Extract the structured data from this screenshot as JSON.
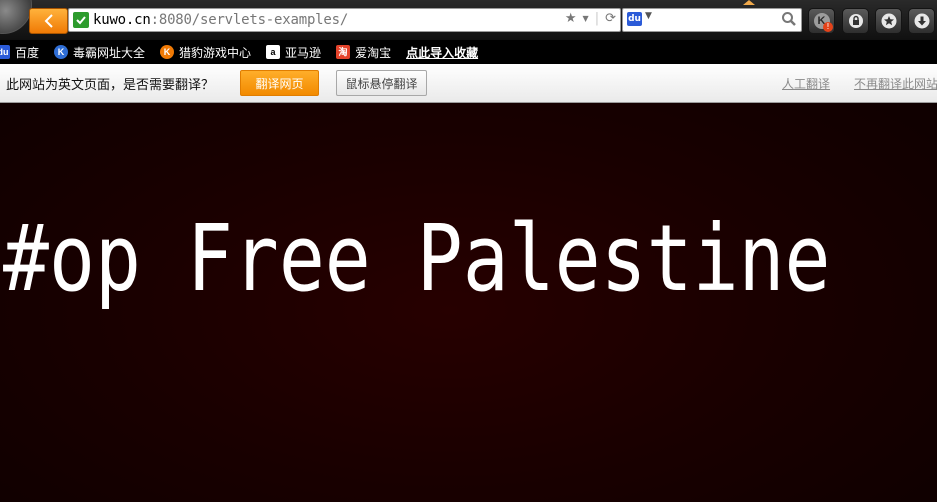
{
  "browser": {
    "address_bar": {
      "host": "kuwo.cn",
      "rest": ":8080/servlets-examples/"
    },
    "icons": {
      "back": "back-arrow-icon",
      "secure": "green-check-icon",
      "bookmark": "star-icon",
      "dropdown": "chevron-down-icon",
      "reload": "reload-icon",
      "search_engine": "baidu-paw-icon",
      "search": "magnifier-icon",
      "extensions": [
        "kingsoft-k-icon",
        "lock-icon",
        "favorites-star-icon",
        "download-icon"
      ]
    },
    "accent_color": "#f28a00"
  },
  "bookmarks": [
    {
      "label": "百度",
      "icon": "baidu-paw-icon"
    },
    {
      "label": "毒霸网址大全",
      "icon": "duba-k-icon"
    },
    {
      "label": "猎豹游戏中心",
      "icon": "liebao-game-icon"
    },
    {
      "label": "亚马逊",
      "icon": "amazon-icon"
    },
    {
      "label": "爱淘宝",
      "icon": "taobao-icon"
    },
    {
      "label": "点此导入收藏",
      "icon": null
    }
  ],
  "translate_bar": {
    "message": "此网站为英文页面，是否需要翻译？",
    "translate_button": "翻译网页",
    "hover_translate_button": "鼠标悬停翻译",
    "human_translate_link": "人工翻译",
    "never_translate_link": "不再翻译此网站"
  },
  "page": {
    "headline": "#op Free Palestine",
    "background_color": "#1e0000",
    "text_color": "#ffffff"
  }
}
